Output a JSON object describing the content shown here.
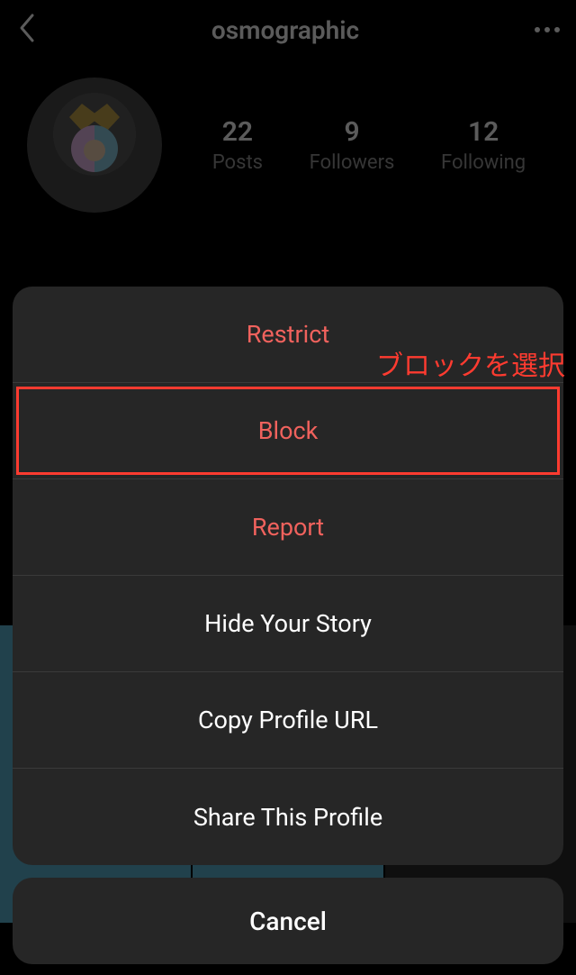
{
  "header": {
    "username": "osmographic"
  },
  "stats": {
    "posts": {
      "count": "22",
      "label": "Posts"
    },
    "followers": {
      "count": "9",
      "label": "Followers"
    },
    "following": {
      "count": "12",
      "label": "Following"
    }
  },
  "sheet": {
    "restrict": "Restrict",
    "block": "Block",
    "report": "Report",
    "hide_story": "Hide Your Story",
    "copy_url": "Copy Profile URL",
    "share": "Share This Profile",
    "cancel": "Cancel"
  },
  "annotation": {
    "text": "ブロックを選択"
  }
}
